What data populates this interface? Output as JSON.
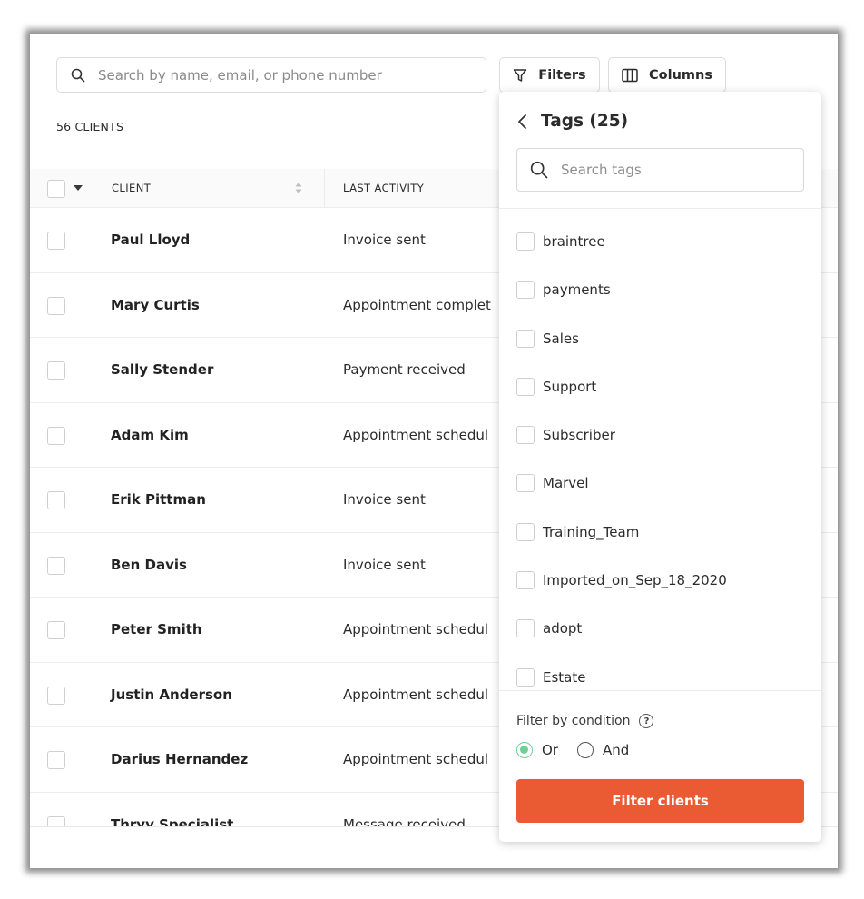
{
  "toolbar": {
    "search_placeholder": "Search by name, email, or phone number",
    "filters_label": "Filters",
    "columns_label": "Columns"
  },
  "client_count": "56 CLIENTS",
  "table": {
    "headers": {
      "client": "CLIENT",
      "last_activity": "LAST ACTIVITY"
    },
    "rows": [
      {
        "name": "Paul Lloyd",
        "activity": "Invoice sent"
      },
      {
        "name": "Mary Curtis",
        "activity": "Appointment complet"
      },
      {
        "name": "Sally Stender",
        "activity": "Payment received"
      },
      {
        "name": "Adam Kim",
        "activity": "Appointment schedul"
      },
      {
        "name": "Erik Pittman",
        "activity": "Invoice sent"
      },
      {
        "name": "Ben Davis",
        "activity": "Invoice sent"
      },
      {
        "name": "Peter Smith",
        "activity": "Appointment schedul"
      },
      {
        "name": "Justin Anderson",
        "activity": "Appointment schedul"
      },
      {
        "name": "Darius Hernandez",
        "activity": "Appointment schedul"
      },
      {
        "name": "Thryv Specialist",
        "activity": "Message received"
      }
    ]
  },
  "filter_panel": {
    "title": "Tags (25)",
    "search_placeholder": "Search tags",
    "tags": [
      "braintree",
      "payments",
      "Sales",
      "Support",
      "Subscriber",
      "Marvel",
      "Training_Team",
      "Imported_on_Sep_18_2020",
      "adopt",
      "Estate"
    ],
    "condition_label": "Filter by condition",
    "help_glyph": "?",
    "options": {
      "or": "Or",
      "and": "And"
    },
    "selected_condition": "Or",
    "submit_label": "Filter clients"
  },
  "colors": {
    "accent": "#ea5b33",
    "radio_selected": "#6fcf97"
  },
  "icons": [
    "search-icon",
    "filter-icon",
    "columns-icon",
    "chevron-down-icon",
    "sort-icon",
    "chevron-left-icon",
    "help-icon"
  ]
}
